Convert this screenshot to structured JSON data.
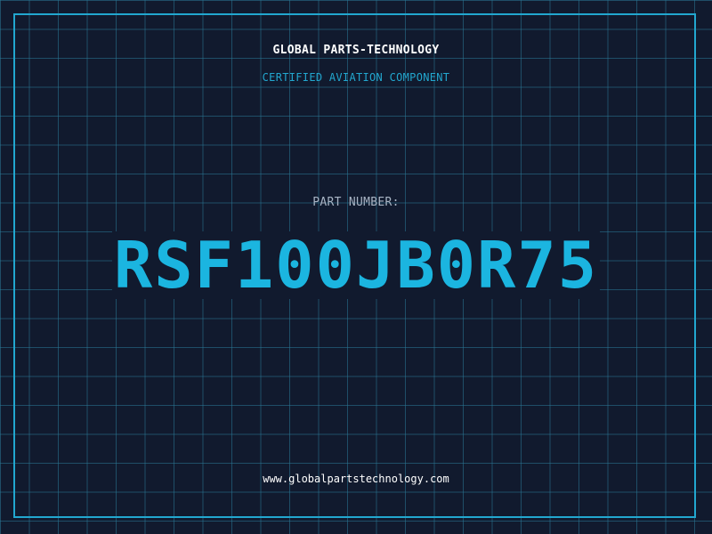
{
  "header": {
    "company": "GLOBAL PARTS-TECHNOLOGY",
    "subtitle": "CERTIFIED AVIATION COMPONENT"
  },
  "part": {
    "label": "PART NUMBER:",
    "number": "RSF100JB0R75"
  },
  "footer": {
    "website": "www.globalpartstechnology.com"
  },
  "colors": {
    "background": "#111a2e",
    "grid": "#2a7896",
    "accent": "#22a7cf",
    "part_number": "#1bb5e0",
    "text": "#ffffff",
    "label": "#a8b4c4"
  }
}
